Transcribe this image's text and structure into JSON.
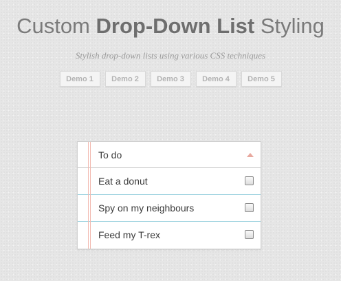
{
  "header": {
    "title_light": "Custom ",
    "title_bold": "Drop-Down List",
    "title_end": " Styling",
    "subtitle": "Stylish drop-down lists using various CSS techniques"
  },
  "demos": [
    "Demo 1",
    "Demo 2",
    "Demo 3",
    "Demo 4",
    "Demo 5"
  ],
  "dropdown": {
    "label": "To do",
    "items": [
      {
        "label": "Eat a donut",
        "checked": false
      },
      {
        "label": "Spy on my neighbours",
        "checked": false
      },
      {
        "label": "Feed my T-rex",
        "checked": false
      }
    ]
  }
}
